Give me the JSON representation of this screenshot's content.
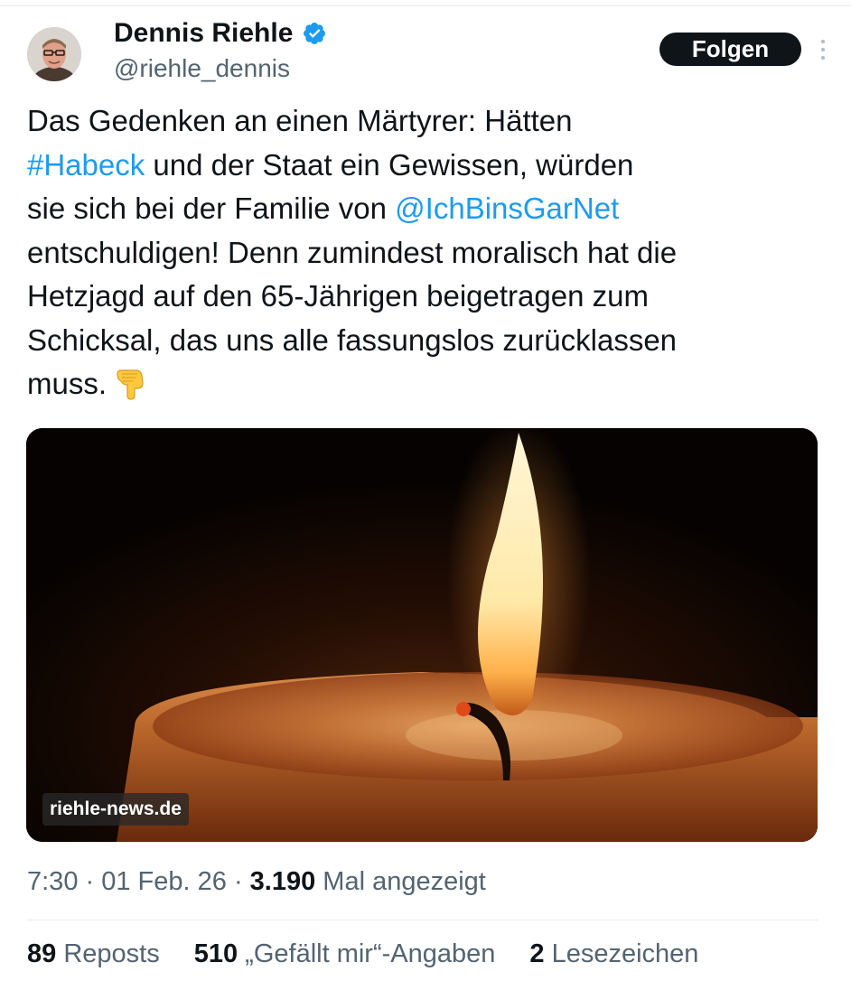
{
  "author": {
    "display_name": "Dennis Riehle",
    "handle": "@riehle_dennis",
    "verified_icon": "verified-badge-icon"
  },
  "header": {
    "follow_label": "Folgen",
    "more_icon": "more-options-icon"
  },
  "tweet": {
    "text_1": "Das Gedenken an einen Märtyrer: Hätten\n",
    "hashtag": "#Habeck",
    "text_2": " und der Staat ein Gewissen, würden\nsie sich bei der Familie von ",
    "mention": "@IchBinsGarNet",
    "text_3": "\nentschuldigen! Denn zumindest moralisch hat die\nHetzjagd auf den 65-Jährigen beigetragen zum\nSchicksal, das uns alle fassungslos zurücklassen\nmuss.",
    "emoji": "pointing-down-hand-emoji"
  },
  "media": {
    "watermark": "riehle-news.de"
  },
  "meta": {
    "time": "7:30",
    "sep1": " · ",
    "date": "01 Feb. 26",
    "sep2": " · ",
    "views_count": "3.190",
    "views_label": " Mal angezeigt"
  },
  "stats": {
    "reposts_count": "89",
    "reposts_label": " Reposts",
    "likes_count": "510",
    "likes_label": " „Gefällt mir“-Angaben",
    "bookmarks_count": "2",
    "bookmarks_label": " Lesezeichen"
  },
  "colors": {
    "link": "#1d9bf0",
    "text": "#0f1419",
    "secondary": "#536471",
    "follow_bg": "#0f1419"
  }
}
